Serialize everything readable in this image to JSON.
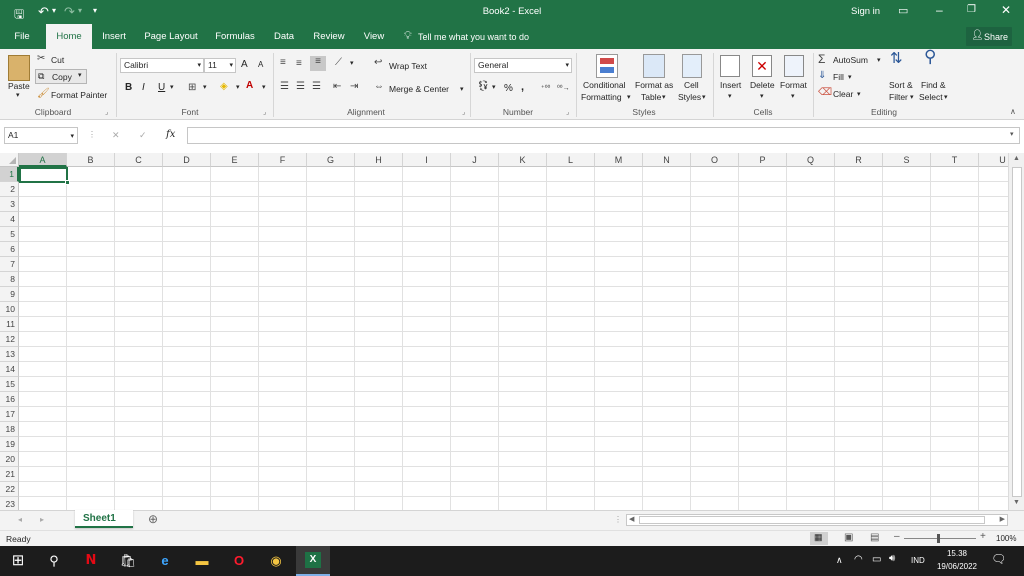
{
  "titlebar": {
    "title": "Book2  -  Excel",
    "signin": "Sign in"
  },
  "tabs": [
    "File",
    "Home",
    "Insert",
    "Page Layout",
    "Formulas",
    "Data",
    "Review",
    "View"
  ],
  "tellme": "Tell me what you want to do",
  "share": "Share",
  "ribbon": {
    "clipboard": {
      "paste": "Paste",
      "cut": "Cut",
      "copy": "Copy",
      "format_painter": "Format Painter",
      "label": "Clipboard"
    },
    "font": {
      "name": "Calibri",
      "size": "11",
      "label": "Font",
      "bold": "B",
      "italic": "I",
      "underline": "U",
      "grow": "A",
      "shrink": "A"
    },
    "alignment": {
      "wrap": "Wrap Text",
      "merge": "Merge & Center",
      "label": "Alignment"
    },
    "number": {
      "format": "General",
      "percent": "%",
      "comma": ",",
      "label": "Number"
    },
    "styles": {
      "conditional": "Conditional",
      "conditional2": "Formatting",
      "format_table": "Format as",
      "format_table2": "Table",
      "cell_styles": "Cell",
      "cell_styles2": "Styles",
      "label": "Styles"
    },
    "cells": {
      "insert": "Insert",
      "delete": "Delete",
      "format": "Format",
      "label": "Cells"
    },
    "editing": {
      "autosum": "AutoSum",
      "fill": "Fill",
      "clear": "Clear",
      "sort": "Sort &",
      "sort2": "Filter",
      "find": "Find &",
      "find2": "Select",
      "label": "Editing"
    }
  },
  "formula_bar": {
    "name_box": "A1",
    "fx": "fx",
    "cancel": "✕",
    "enter": "✓"
  },
  "grid": {
    "columns": [
      "A",
      "B",
      "C",
      "D",
      "E",
      "F",
      "G",
      "H",
      "I",
      "J",
      "K",
      "L",
      "M",
      "N",
      "O",
      "P",
      "Q",
      "R",
      "S",
      "T",
      "U"
    ],
    "rows": [
      "1",
      "2",
      "3",
      "4",
      "5",
      "6",
      "7",
      "8",
      "9",
      "10",
      "11",
      "12",
      "13",
      "14",
      "15",
      "16",
      "17",
      "18",
      "19",
      "20",
      "21",
      "22",
      "23"
    ]
  },
  "sheet_tab": "Sheet1",
  "status": {
    "ready": "Ready",
    "zoom": "100%"
  },
  "taskbar": {
    "lang": "IND",
    "time": "15.38",
    "date": "19/06/2022"
  }
}
